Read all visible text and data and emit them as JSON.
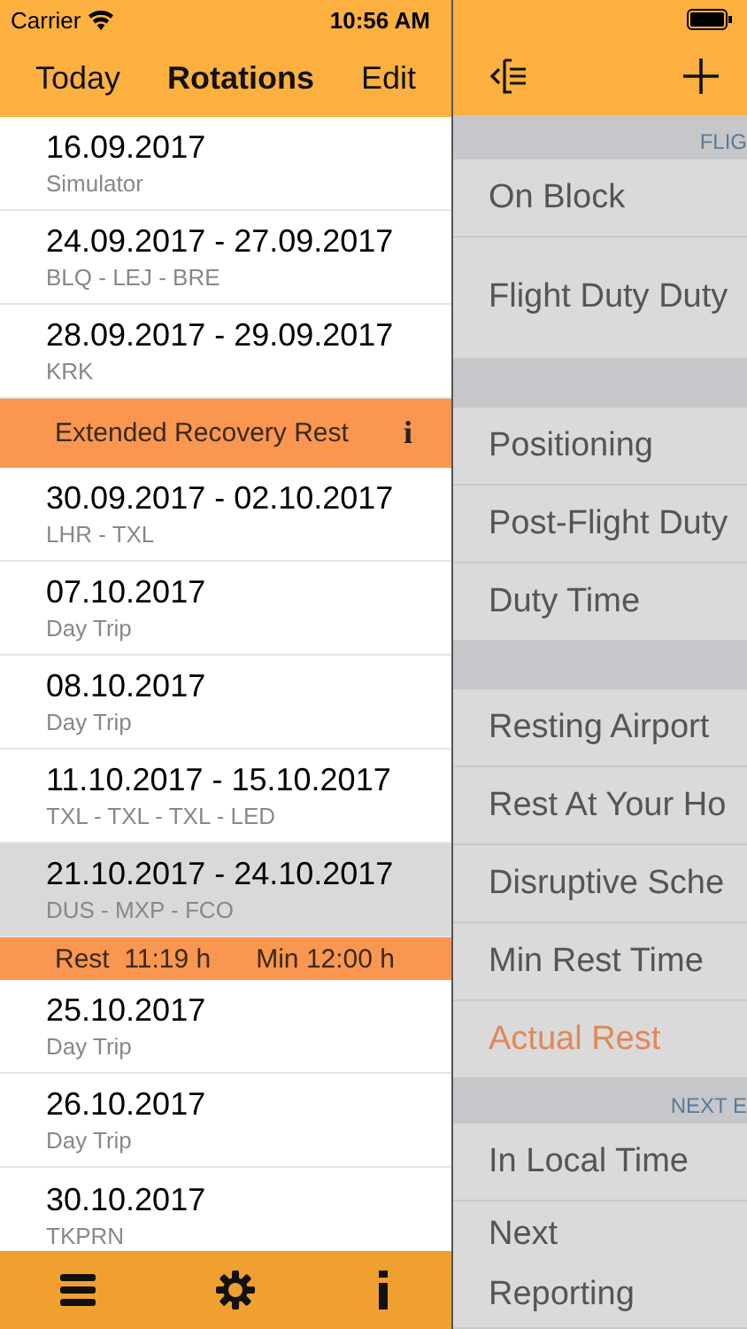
{
  "status_bar": {
    "carrier": "Carrier",
    "time": "10:56 AM"
  },
  "nav": {
    "left": "Today",
    "title": "Rotations",
    "right": "Edit"
  },
  "rotations": [
    {
      "kind": "rotation",
      "date": "16.09.2017",
      "detail": "Simulator",
      "selected": false
    },
    {
      "kind": "rotation",
      "date": "24.09.2017 - 27.09.2017",
      "detail": "BLQ - LEJ - BRE",
      "selected": false
    },
    {
      "kind": "rotation",
      "date": "28.09.2017 - 29.09.2017",
      "detail": "KRK",
      "selected": false
    },
    {
      "kind": "banner",
      "text": "Extended Recovery Rest",
      "icon": "i"
    },
    {
      "kind": "rotation",
      "date": "30.09.2017 - 02.10.2017",
      "detail": "LHR - TXL",
      "selected": false
    },
    {
      "kind": "rotation",
      "date": "07.10.2017",
      "detail": "Day Trip",
      "selected": false
    },
    {
      "kind": "rotation",
      "date": "08.10.2017",
      "detail": "Day Trip",
      "selected": false
    },
    {
      "kind": "rotation",
      "date": "11.10.2017 - 15.10.2017",
      "detail": "TXL - TXL - TXL - LED",
      "selected": false
    },
    {
      "kind": "rotation",
      "date": "21.10.2017 - 24.10.2017",
      "detail": "DUS - MXP - FCO",
      "selected": true
    },
    {
      "kind": "rest",
      "rest": "Rest  11:19 h",
      "min": "Min 12:00 h"
    },
    {
      "kind": "rotation",
      "date": "25.10.2017",
      "detail": "Day Trip",
      "selected": false
    },
    {
      "kind": "rotation",
      "date": "26.10.2017",
      "detail": "Day Trip",
      "selected": false
    },
    {
      "kind": "rotation",
      "date": "30.10.2017",
      "detail": "TKPRN",
      "selected": false
    }
  ],
  "detail_panel": [
    {
      "kind": "header",
      "text": "FLIG"
    },
    {
      "kind": "row",
      "label": "On Block",
      "highlighted": false
    },
    {
      "kind": "tall_row",
      "label": "Flight Duty Duty",
      "highlighted": false
    },
    {
      "kind": "gap"
    },
    {
      "kind": "row",
      "label": "Positioning",
      "highlighted": false
    },
    {
      "kind": "row",
      "label": "Post-Flight Duty",
      "highlighted": false
    },
    {
      "kind": "row",
      "label": "Duty Time",
      "highlighted": false
    },
    {
      "kind": "gap"
    },
    {
      "kind": "row",
      "label": "Resting Airport",
      "highlighted": false
    },
    {
      "kind": "row",
      "label": "Rest At Your Ho",
      "highlighted": false
    },
    {
      "kind": "row",
      "label": "Disruptive Sche",
      "highlighted": false
    },
    {
      "kind": "row",
      "label": "Min Rest Time",
      "highlighted": false
    },
    {
      "kind": "row",
      "label": "Actual Rest",
      "highlighted": true
    },
    {
      "kind": "header",
      "text": "NEXT E"
    },
    {
      "kind": "row",
      "label": "In Local Time",
      "highlighted": false
    },
    {
      "kind": "two_line_row",
      "lines": [
        "Next",
        "Reporting"
      ],
      "highlighted": false
    }
  ]
}
